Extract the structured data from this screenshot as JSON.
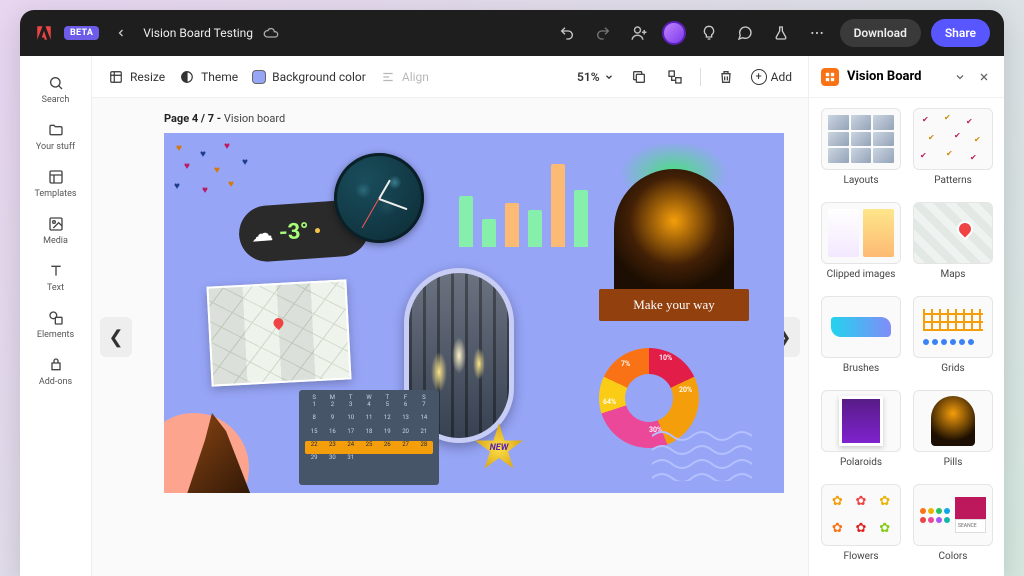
{
  "topbar": {
    "beta": "BETA",
    "title": "Vision Board Testing",
    "download": "Download",
    "share": "Share"
  },
  "rail": {
    "search": "Search",
    "your_stuff": "Your stuff",
    "templates": "Templates",
    "media": "Media",
    "text": "Text",
    "elements": "Elements",
    "addons": "Add-ons"
  },
  "toolbar": {
    "resize": "Resize",
    "theme": "Theme",
    "bgcolor": "Background color",
    "align": "Align",
    "zoom": "51%",
    "add": "Add"
  },
  "page": {
    "prefix": "Page 4 / 7 - ",
    "name": "Vision board"
  },
  "canvas": {
    "temp": "-3°",
    "ribbon": "Make your way",
    "new_badge": "NEW",
    "donut": {
      "a": "10%",
      "b": "20%",
      "c": "30%",
      "d": "64%",
      "e": "7%"
    },
    "cal_head": [
      "S",
      "M",
      "T",
      "W",
      "T",
      "F",
      "S"
    ]
  },
  "chart_data": {
    "type": "bar",
    "categories": [
      "1",
      "2",
      "3",
      "4",
      "5",
      "6"
    ],
    "values": [
      55,
      30,
      48,
      40,
      90,
      62
    ],
    "colors": [
      "#86efac",
      "#86efac",
      "#fdba74",
      "#86efac",
      "#fdba74",
      "#86efac"
    ],
    "ylim": [
      0,
      100
    ],
    "title": "",
    "xlabel": "",
    "ylabel": ""
  },
  "panel": {
    "title": "Vision Board",
    "cards": {
      "layouts": "Layouts",
      "patterns": "Patterns",
      "clipped": "Clipped images",
      "maps": "Maps",
      "brushes": "Brushes",
      "grids": "Grids",
      "polaroids": "Polaroids",
      "pills": "Pills",
      "flowers": "Flowers",
      "colors": "Colors"
    }
  }
}
